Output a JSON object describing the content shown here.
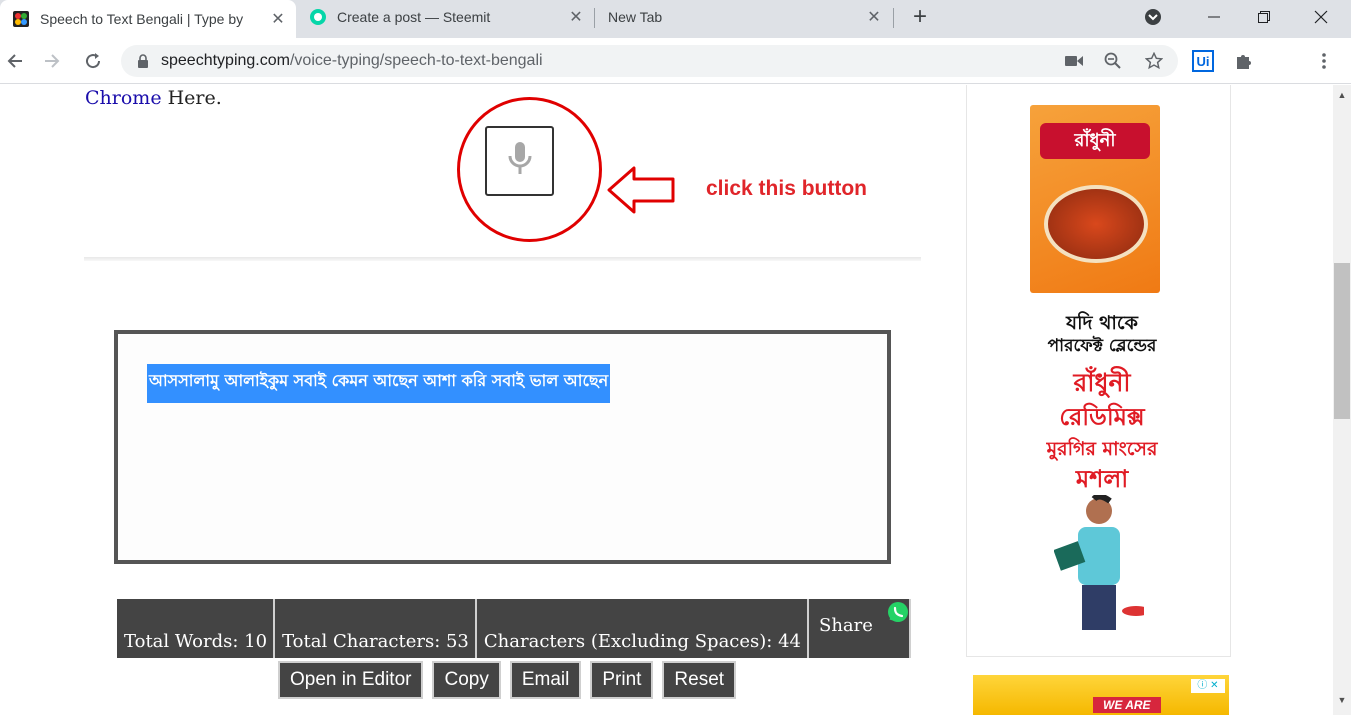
{
  "browser": {
    "tabs": [
      {
        "title": "Speech to Text Bengali | Type by",
        "active": true
      },
      {
        "title": "Create a post — Steemit",
        "active": false
      },
      {
        "title": "New Tab",
        "active": false
      }
    ],
    "tab_close_glyph": "✕",
    "new_tab_glyph": "+",
    "url_domain": "speechtyping.com",
    "url_path": "/voice-typing/speech-to-text-bengali",
    "extension_label": "Ui"
  },
  "page": {
    "intro_link": "Chrome",
    "intro_rest": " Here.",
    "annotation": "click this button",
    "textbox_content": "আসসালামু আলাইকুম সবাই কেমন আছেন আশা করি সবাই ভাল আছেন",
    "stats": {
      "words": "Total Words: 10",
      "chars": "Total Characters: 53",
      "chars_no_space": "Characters (Excluding Spaces): 44",
      "share": "Share"
    },
    "actions": [
      "Open in Editor",
      "Copy",
      "Email",
      "Print",
      "Reset"
    ]
  },
  "ad": {
    "brand": "রাঁধুনী",
    "lines": [
      "যদি থাকে",
      "পারফেক্ট ব্লেন্ডের",
      "রাঁধুনী",
      "রেডিমিক্স",
      "মুরগির মাংসের",
      "মশলা"
    ],
    "colors": {
      "headline": "#111111",
      "brand_red": "#e01b24"
    },
    "banner_text": "WE ARE"
  },
  "colors": {
    "accent_red": "#e0252a",
    "selection_blue": "#3390ff",
    "stats_bg": "#444444",
    "link_blue": "#1a0dab"
  }
}
